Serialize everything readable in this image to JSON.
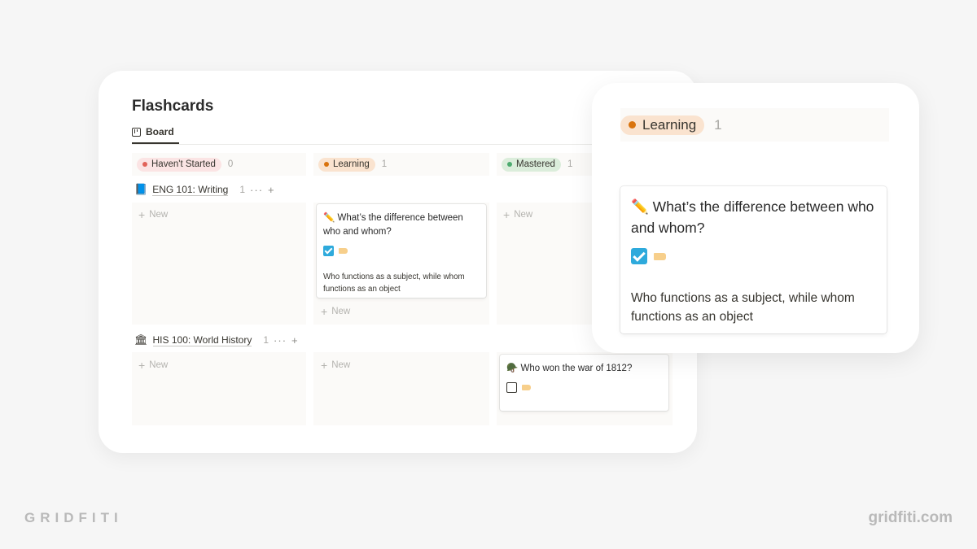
{
  "page": {
    "title": "Flashcards",
    "view_tab": "Board"
  },
  "columns": [
    {
      "label": "Haven't Started",
      "count": "0",
      "bg": "#fbe4e4",
      "dot": "#e16259"
    },
    {
      "label": "Learning",
      "count": "1",
      "bg": "#fae3cf",
      "dot": "#d9730d"
    },
    {
      "label": "Mastered",
      "count": "1",
      "bg": "#dbeddb",
      "dot": "#4dab6f"
    }
  ],
  "groups": [
    {
      "emoji": "📘",
      "label": "ENG 101: Writing",
      "count": "1"
    },
    {
      "emoji": "🏛",
      "label": "HIS 100: World History",
      "count": "1"
    }
  ],
  "new_label": "New",
  "cards": {
    "eng_learning": {
      "emoji": "✏️",
      "title": "What’s the difference between who and whom?",
      "checked": true,
      "answer": "Who functions as a subject, while whom functions as an object"
    },
    "his_mastered": {
      "emoji": "🪖",
      "title": "Who won the war of 1812?",
      "checked": false
    }
  },
  "zoom": {
    "label": "Learning",
    "count": "1",
    "card_emoji": "✏️",
    "card_title": "What’s the difference between who and whom?",
    "card_answer": "Who functions as a subject, while whom functions as an object"
  },
  "icons": {
    "board": "board-view-icon",
    "plus": "plus-icon",
    "more": "more-dots-icon",
    "tag": "tag-icon"
  },
  "branding": {
    "left": "GRIDFITI",
    "right": "gridfiti.com"
  }
}
